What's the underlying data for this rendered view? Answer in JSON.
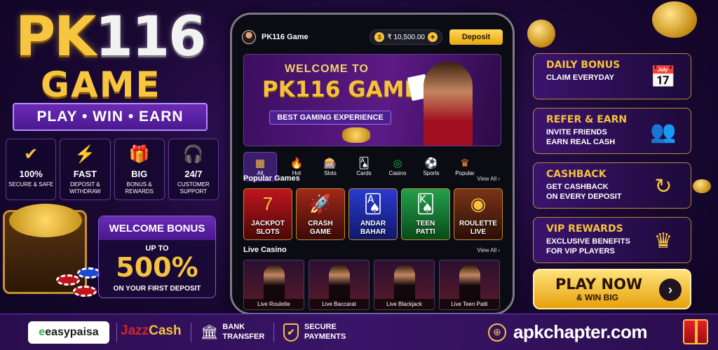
{
  "logo": {
    "line1a": "PK",
    "line1b": "116",
    "line2": "GAME",
    "tagline": "PLAY • WIN • EARN"
  },
  "features": [
    {
      "icon": "shield-check-icon",
      "glyph": "✔",
      "title": "100%",
      "sub": "SECURE & SAFE"
    },
    {
      "icon": "lightning-icon",
      "glyph": "⚡",
      "title": "FAST",
      "sub": "DEPOSIT & WITHDRAW"
    },
    {
      "icon": "gift-icon",
      "glyph": "🎁",
      "title": "BIG",
      "sub": "BONUS & REWARDS"
    },
    {
      "icon": "headset-icon",
      "glyph": "🎧",
      "title": "24/7",
      "sub": "CUSTOMER SUPPORT"
    }
  ],
  "welcome_bonus": {
    "title": "WELCOME BONUS",
    "upto": "UP TO",
    "percent": "500%",
    "sub": "ON YOUR FIRST DEPOSIT"
  },
  "phone": {
    "header": {
      "title": "PK116 Game",
      "balance": "₹ 10,500.00",
      "deposit_label": "Deposit"
    },
    "hero": {
      "line1": "WELCOME TO",
      "line2": "PK116 GAME",
      "line3": "BEST GAMING EXPERIENCE"
    },
    "categories": [
      {
        "glyph": "▦",
        "label": "All",
        "icon": "grid-icon"
      },
      {
        "glyph": "🔥",
        "label": "Hot",
        "icon": "flame-icon"
      },
      {
        "glyph": "🎰",
        "label": "Slots",
        "icon": "slot-machine-icon"
      },
      {
        "glyph": "🂡",
        "label": "Cards",
        "icon": "cards-icon"
      },
      {
        "glyph": "◎",
        "label": "Casino",
        "icon": "chip-icon"
      },
      {
        "glyph": "⚽",
        "label": "Sports",
        "icon": "soccer-ball-icon"
      },
      {
        "glyph": "♛",
        "label": "Popular",
        "icon": "crown-icon"
      }
    ],
    "popular": {
      "title": "Popular Games",
      "view_all": "View All ›",
      "games": [
        {
          "line1": "JACKPOT",
          "line2": "SLOTS",
          "glyph": "7",
          "color": "#8a1c1c"
        },
        {
          "line1": "CRASH",
          "line2": "GAME",
          "glyph": "🚀",
          "color": "#6a1a12"
        },
        {
          "line1": "ANDAR",
          "line2": "BAHAR",
          "glyph": "🂡",
          "color": "#1a2a8a"
        },
        {
          "line1": "TEEN",
          "line2": "PATTI",
          "glyph": "🂮",
          "color": "#136a2a"
        },
        {
          "line1": "ROULETTE",
          "line2": "LIVE",
          "glyph": "◉",
          "color": "#5a2410"
        }
      ]
    },
    "live": {
      "title": "Live Casino",
      "view_all": "View All ›",
      "tables": [
        "Live Roulette",
        "Live Baccarat",
        "Live Blackjack",
        "Live Teen Patti"
      ]
    }
  },
  "promos": [
    {
      "title": "DAILY BONUS",
      "sub1": "CLAIM EVERYDAY",
      "sub2": "",
      "icon": "calendar-gift-icon",
      "glyph": "📅"
    },
    {
      "title": "REFER & EARN",
      "sub1": "INVITE FRIENDS",
      "sub2": "EARN REAL CASH",
      "icon": "referral-icon",
      "glyph": "👥"
    },
    {
      "title": "CASHBACK",
      "sub1": "GET CASHBACK",
      "sub2": "ON EVERY DEPOSIT",
      "icon": "cashback-arrow-icon",
      "glyph": "↻"
    },
    {
      "title": "VIP REWARDS",
      "sub1": "EXCLUSIVE BENEFITS",
      "sub2": "FOR VIP PLAYERS",
      "icon": "vip-crown-icon",
      "glyph": "♛"
    }
  ],
  "play_now": {
    "line1": "PLAY NOW",
    "line2": "& WIN BIG"
  },
  "footer": {
    "easypaisa_e": "e",
    "easypaisa_rest": "easypaisa",
    "jazz_a": "Jazz",
    "jazz_b": "Cash",
    "bank1": "BANK",
    "bank2": "TRANSFER",
    "secure1": "SECURE",
    "secure2": "PAYMENTS",
    "site": "apkchapter.com"
  },
  "colors": {
    "gold": "#f6c23e",
    "purple": "#3a1468",
    "deposit": "#e8a70e"
  }
}
